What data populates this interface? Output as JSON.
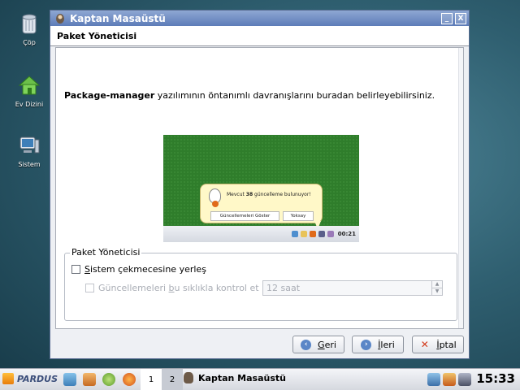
{
  "desktop": {
    "icons": [
      {
        "label": "Çöp"
      },
      {
        "label": "Ev Dizini"
      },
      {
        "label": "Sistem"
      }
    ]
  },
  "window": {
    "title": "Kaptan Masaüstü",
    "minimize": "_",
    "close": "X",
    "header": "Paket Yöneticisi",
    "description_bold": "Package-manager",
    "description_rest": " yazılımının öntanımlı davranışlarını buradan belirleyebilirsiniz.",
    "preview": {
      "balloon_prefix": "Mevcut ",
      "balloon_count": "38",
      "balloon_suffix": " güncelleme bulunuyor!",
      "show_button": "Güncellemeleri Göster",
      "ignore_button": "Yoksay",
      "clock": "00:21"
    },
    "groupbox": {
      "title": "Paket Yöneticisi",
      "tray_checkbox_pre": "",
      "tray_checkbox_u": "S",
      "tray_checkbox_post": "istem çekmecesine yerleş",
      "tray_checked": false,
      "interval_pre": "Güncellemeleri ",
      "interval_u": "b",
      "interval_post": "u sıklıkla kontrol et",
      "interval_enabled": false,
      "interval_value": "12 saat"
    },
    "buttons": {
      "back_u": "G",
      "back_rest": "eri",
      "next_u": "İ",
      "next_rest": "leri",
      "cancel_u": "İ",
      "cancel_rest": "ptal"
    }
  },
  "taskbar": {
    "start_label": "PARDUS",
    "desktops": [
      "1",
      "2"
    ],
    "task_title": "Kaptan Masaüstü",
    "clock": "15:33"
  },
  "colors": {
    "titlebar": "#5d7cb8",
    "preview_bg": "#2f7d2b",
    "balloon_bg": "#fff8c8"
  }
}
